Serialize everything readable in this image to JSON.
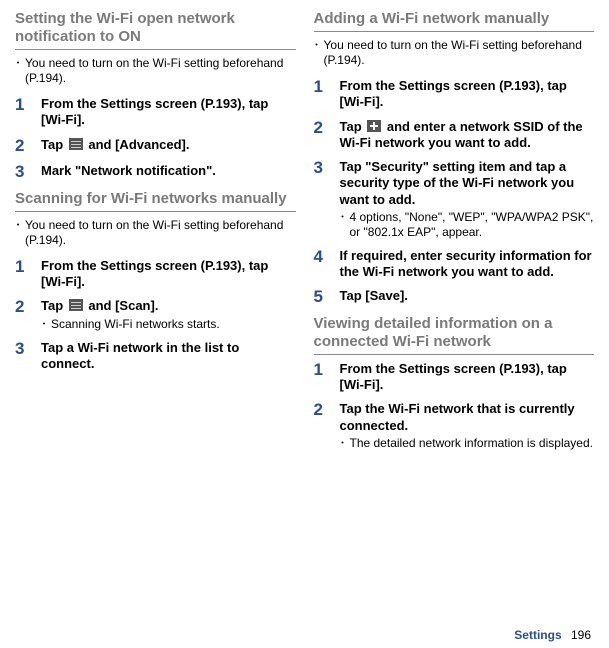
{
  "left": {
    "section1": {
      "title": "Setting the Wi-Fi open network notification to ON",
      "bullet": "You need to turn on the Wi-Fi setting beforehand (P.194).",
      "steps": [
        {
          "num": "1",
          "instr": "From the Settings screen (P.193), tap [Wi-Fi]."
        },
        {
          "num": "2",
          "instr_pre": "Tap ",
          "instr_post": " and [Advanced].",
          "icon": "menu"
        },
        {
          "num": "3",
          "instr": "Mark \"Network notification\"."
        }
      ]
    },
    "section2": {
      "title": "Scanning for Wi-Fi networks manually",
      "bullet": "You need to turn on the Wi-Fi setting beforehand (P.194).",
      "steps": [
        {
          "num": "1",
          "instr": "From the Settings screen (P.193), tap [Wi-Fi]."
        },
        {
          "num": "2",
          "instr_pre": "Tap ",
          "instr_post": " and [Scan].",
          "icon": "menu",
          "sub": "Scanning Wi-Fi networks starts."
        },
        {
          "num": "3",
          "instr": "Tap a Wi-Fi network in the list to connect."
        }
      ]
    }
  },
  "right": {
    "section1": {
      "title": "Adding a Wi-Fi network manually",
      "bullet": "You need to turn on the Wi-Fi setting beforehand (P.194).",
      "steps": [
        {
          "num": "1",
          "instr": "From the Settings screen (P.193), tap [Wi-Fi]."
        },
        {
          "num": "2",
          "instr_pre": "Tap ",
          "instr_post": " and enter a network SSID of the Wi-Fi network you want to add.",
          "icon": "plus"
        },
        {
          "num": "3",
          "instr": "Tap \"Security\" setting item and tap a security type of the Wi-Fi network you want to add.",
          "sub": "4 options, \"None\", \"WEP\", \"WPA/WPA2 PSK\", or \"802.1x EAP\", appear."
        },
        {
          "num": "4",
          "instr": "If required, enter security information for the Wi-Fi network you want to add."
        },
        {
          "num": "5",
          "instr": "Tap [Save]."
        }
      ]
    },
    "section2": {
      "title": "Viewing detailed information on a connected Wi-Fi network",
      "steps": [
        {
          "num": "1",
          "instr": "From the Settings screen (P.193), tap [Wi-Fi]."
        },
        {
          "num": "2",
          "instr": "Tap the Wi-Fi network that is currently connected.",
          "sub": "The detailed network information is displayed."
        }
      ]
    }
  },
  "footer": {
    "label": "Settings",
    "page": "196"
  }
}
